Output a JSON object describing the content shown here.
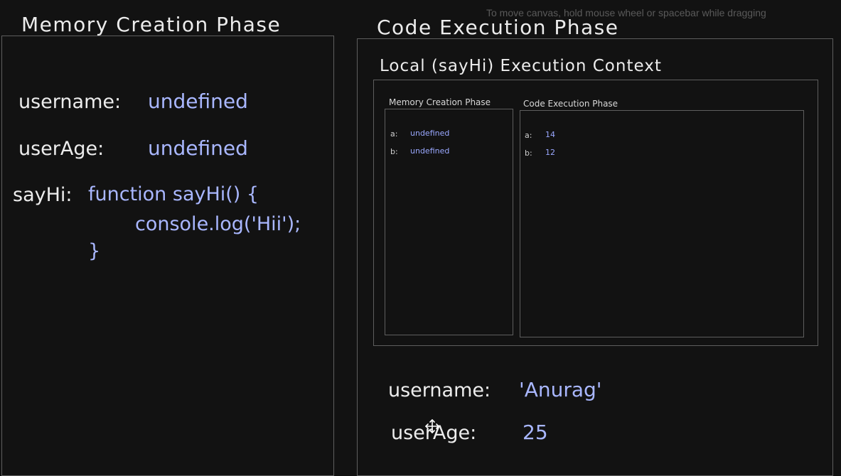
{
  "hint": "To move canvas, hold mouse wheel or spacebar while dragging",
  "left_panel": {
    "title": "Memory Creation Phase",
    "entries": [
      {
        "label": "username:",
        "value": "undefined"
      },
      {
        "label": "userAge:",
        "value": "undefined"
      }
    ],
    "function_entry": {
      "label": "sayHi:",
      "line1": "function sayHi() {",
      "line2": "console.log('Hii');",
      "line3": "}"
    }
  },
  "right_panel": {
    "title": "Code Execution Phase",
    "local_context": {
      "title": "Local (sayHi) Execution Context",
      "memory": {
        "title": "Memory Creation Phase",
        "entries": [
          {
            "label": "a:",
            "value": "undefined"
          },
          {
            "label": "b:",
            "value": "undefined"
          }
        ]
      },
      "execution": {
        "title": "Code Execution Phase",
        "entries": [
          {
            "label": "a:",
            "value": "14"
          },
          {
            "label": "b:",
            "value": "12"
          }
        ]
      }
    },
    "entries": [
      {
        "label": "username:",
        "value": "'Anurag'"
      },
      {
        "label": "userAge:",
        "value": "25"
      }
    ]
  },
  "colors": {
    "background": "#121212",
    "text": "#ececec",
    "value": "#a9b7ff",
    "border": "#5e5e5e"
  }
}
